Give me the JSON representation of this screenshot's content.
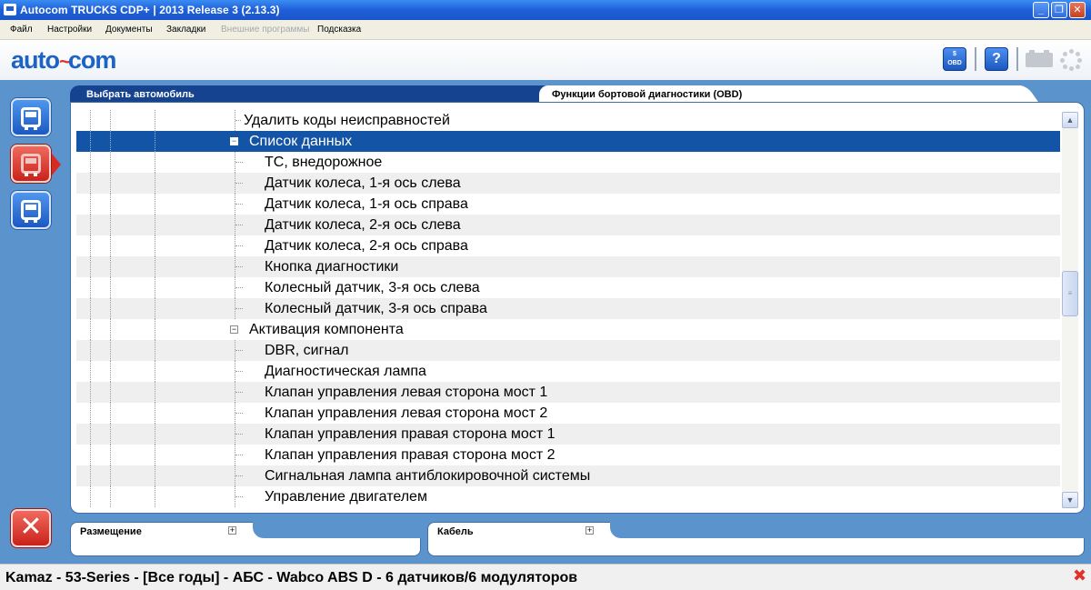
{
  "window": {
    "title": "Autocom TRUCKS CDP+  |  2013 Release 3 (2.13.3)",
    "min_label": "_",
    "max_label": "❐",
    "close_label": "✕"
  },
  "menu": {
    "items": [
      "Файл",
      "Настройки",
      "Документы",
      "Закладки",
      "Внешние программы",
      "Подсказка"
    ]
  },
  "logo": {
    "part1": "auto",
    "pulse": "~",
    "part2": "com"
  },
  "toolbar": {
    "obd_dollar": "$",
    "obd_label": "OBD",
    "help_label": "?"
  },
  "tabs": {
    "left": "Выбрать автомобиль",
    "right": "Функции бортовой диагностики (OBD)"
  },
  "tree": {
    "rows": [
      {
        "label": "Удалить коды неисправностей",
        "level": 2,
        "type": "leaf"
      },
      {
        "label": "Список данных",
        "level": 1,
        "type": "expanded",
        "selected": true
      },
      {
        "label": "ТС, внедорожное",
        "level": 2,
        "type": "leaf"
      },
      {
        "label": "Датчик колеса, 1-я ось слева",
        "level": 2,
        "type": "leaf"
      },
      {
        "label": "Датчик колеса, 1-я ось справа",
        "level": 2,
        "type": "leaf"
      },
      {
        "label": "Датчик колеса, 2-я ось слева",
        "level": 2,
        "type": "leaf"
      },
      {
        "label": "Датчик колеса, 2-я ось справа",
        "level": 2,
        "type": "leaf"
      },
      {
        "label": "Кнопка диагностики",
        "level": 2,
        "type": "leaf"
      },
      {
        "label": "Колесный датчик, 3-я ось слева",
        "level": 2,
        "type": "leaf"
      },
      {
        "label": "Колесный датчик, 3-я ось справа",
        "level": 2,
        "type": "leaf"
      },
      {
        "label": "Активация компонента",
        "level": 1,
        "type": "expanded"
      },
      {
        "label": "DBR, сигнал",
        "level": 2,
        "type": "leaf"
      },
      {
        "label": "Диагностическая лампа",
        "level": 2,
        "type": "leaf"
      },
      {
        "label": "Клапан управления левая сторона мост 1",
        "level": 2,
        "type": "leaf"
      },
      {
        "label": "Клапан управления левая сторона мост 2",
        "level": 2,
        "type": "leaf"
      },
      {
        "label": "Клапан управления правая сторона мост 1",
        "level": 2,
        "type": "leaf"
      },
      {
        "label": "Клапан управления правая сторона мост 2",
        "level": 2,
        "type": "leaf"
      },
      {
        "label": "Сигнальная лампа антиблокировочной системы",
        "level": 2,
        "type": "leaf"
      },
      {
        "label": "Управление двигателем",
        "level": 2,
        "type": "leaf"
      }
    ]
  },
  "scrollbar": {
    "up": "▲",
    "down": "▼",
    "grip": "≡"
  },
  "bottom_panels": {
    "placement": {
      "label": "Размещение",
      "toggle": "+"
    },
    "cable": {
      "label": "Кабель",
      "toggle": "+"
    }
  },
  "status": {
    "text": "Kamaz - 53-Series - [Все годы] - АБС - Wabco ABS D - 6 датчиков/6 модуляторов",
    "close": "✖"
  },
  "colors": {
    "titlebar": "#1f5fd9",
    "workarea": "#5b93cc",
    "tab_active": "#16438f",
    "selected_row": "#1354a6",
    "danger": "#d92a20"
  }
}
